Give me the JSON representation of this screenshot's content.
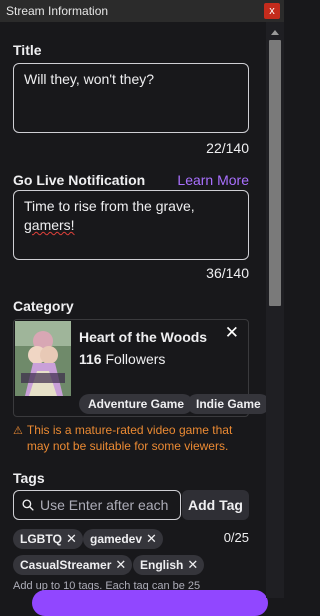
{
  "window": {
    "title": "Stream Information",
    "close_glyph": "x"
  },
  "title_field": {
    "label": "Title",
    "value": "Will they, won't they?",
    "counter": "22/140"
  },
  "notification": {
    "label": "Go Live Notification",
    "learn_more": "Learn More",
    "value_line1": "Time to rise from the grave,",
    "value_line2": "gamers!",
    "counter": "36/140"
  },
  "category": {
    "label": "Category",
    "game_title": "Heart of the Woods",
    "followers_count": "116",
    "followers_label": "Followers",
    "tags": [
      "Adventure Game",
      "Indie Game"
    ],
    "remove_glyph": "✕",
    "warning_icon": "warning-triangle-icon",
    "warning": "This is a mature-rated video game that may not be suitable for some viewers."
  },
  "tags": {
    "label": "Tags",
    "input_placeholder": "Use Enter after each",
    "add_button": "Add Tag",
    "count": "0/25",
    "items": [
      "LGBTQ",
      "gamedev",
      "CasualStreamer",
      "English"
    ],
    "help": "Add up to 10 tags. Each tag can be 25"
  },
  "colors": {
    "accent": "#a970ff",
    "warning": "#eb8a33",
    "button": "#9147ff",
    "window_close": "#c42b1c"
  }
}
